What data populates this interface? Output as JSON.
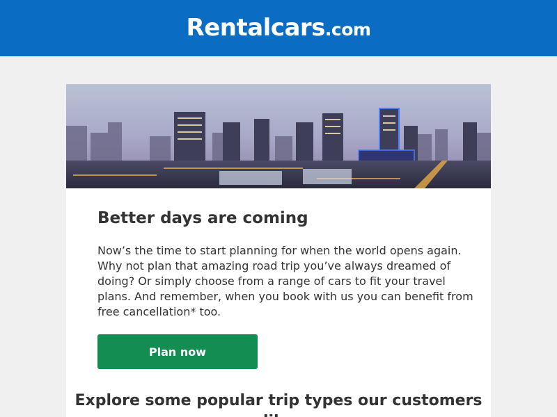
{
  "header": {
    "logo_brand": "Rentalcars",
    "logo_tld": ".com",
    "background_color": "#0a6cc2"
  },
  "hero": {
    "image_description_icon": "city-skyline-image"
  },
  "content": {
    "headline": "Better days are coming",
    "body": "Now’s the time to start planning for when the world opens again. Why not plan that amazing road trip you’ve always dreamed of doing? Or simply choose from a range of cars to fit your travel plans. And remember, when you book with us you can benefit from free cancellation* too.",
    "cta_label": "Plan now",
    "cta_color": "#138d52",
    "section_heading": "Explore some popular trip types our customers like"
  }
}
